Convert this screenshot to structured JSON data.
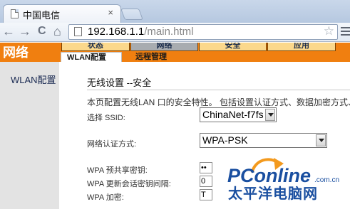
{
  "browser": {
    "tab_title": "中国电信",
    "tab_close": "×",
    "url_host": "192.168.1.1",
    "url_path": "/main.html",
    "back": "←",
    "forward": "→",
    "reload": "C",
    "home": "⌂",
    "star": "☆"
  },
  "router": {
    "brand": "网络",
    "menu": [
      "状态",
      "网络",
      "安全",
      "应用"
    ],
    "submenu": [
      "WLAN配置",
      "远程管理"
    ],
    "sidebar": [
      "WLAN配置"
    ]
  },
  "page": {
    "title": "无线设置 --安全",
    "description": "本页配置无线LAN 口的安全特性。 包括设置认证方式、数据加密方式、",
    "ssid_label": "选择 SSID:",
    "ssid_value": "ChinaNet-f7fs",
    "auth_label": "网络认证方式:",
    "auth_value": "WPA-PSK",
    "wpa_key_label": "WPA 预共享密钥:",
    "wpa_key_value": "••",
    "wpa_rekey_label": "WPA 更新会话密钥间隔:",
    "wpa_rekey_value": "0",
    "wpa_enc_label": "WPA 加密:",
    "wpa_enc_value": "T"
  },
  "watermark": {
    "brand": "PConline",
    "domain": ".com.cn",
    "chinese": "太平洋电脑网"
  },
  "colors": {
    "header_orange": "#f07f10",
    "menu_tab": "#fbd88c",
    "menu_active": "#a8acb0",
    "watermark_blue": "#1a4fa0",
    "watermark_orange": "#f39a1e"
  }
}
